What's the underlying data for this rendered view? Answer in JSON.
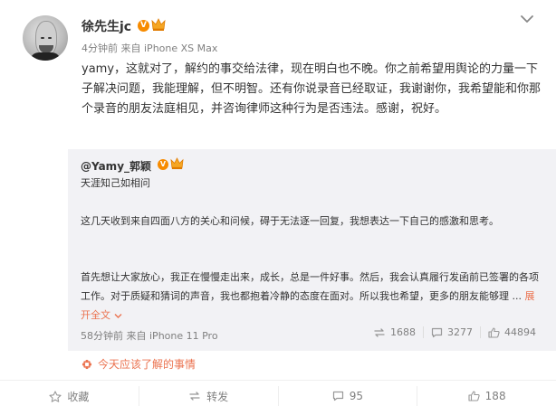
{
  "post": {
    "author": "徐先生jc",
    "verified_badge": "V",
    "time": "4分钟前",
    "source_prefix": "来自",
    "source": "iPhone XS Max",
    "content": "yamy，这就对了，解约的事交给法律，现在明白也不晚。你之前希望用舆论的力量一下子解决问题，我能理解，但不明智。还有你说录音已经取证，我谢谢你，我希望能和你那个录音的朋友法庭相见，并咨询律师这种行为是否违法。感谢，祝好。"
  },
  "retweet": {
    "author": "@Yamy_郭颖",
    "verified_badge": "V",
    "p1": "天涯知己如相问",
    "p2": "这几天收到来自四面八方的关心和问候，碍于无法逐一回复，我想表达一下自己的感激和思考。",
    "p3": "首先想让大家放心，我正在慢慢走出来，成长，总是一件好事。然后，我会认真履行发函前已签署的各项工作。对于质疑和猜词的声音，我也都抱着冷静的态度在面对。所以我也希望，更多的朋友能够理 ...",
    "expand": "展开全文",
    "time": "58分钟前",
    "source_prefix": "来自",
    "source": "iPhone 11 Pro",
    "reposts": "1688",
    "comments": "3277",
    "likes": "44894"
  },
  "topic": {
    "label": "今天应该了解的事情"
  },
  "actions": {
    "favorite": "收藏",
    "repost": "转发",
    "comment": "95",
    "like": "188"
  },
  "colors": {
    "accent": "#eb7350",
    "verified": "#f78b00",
    "retweet_bg": "#f2f2f5"
  }
}
